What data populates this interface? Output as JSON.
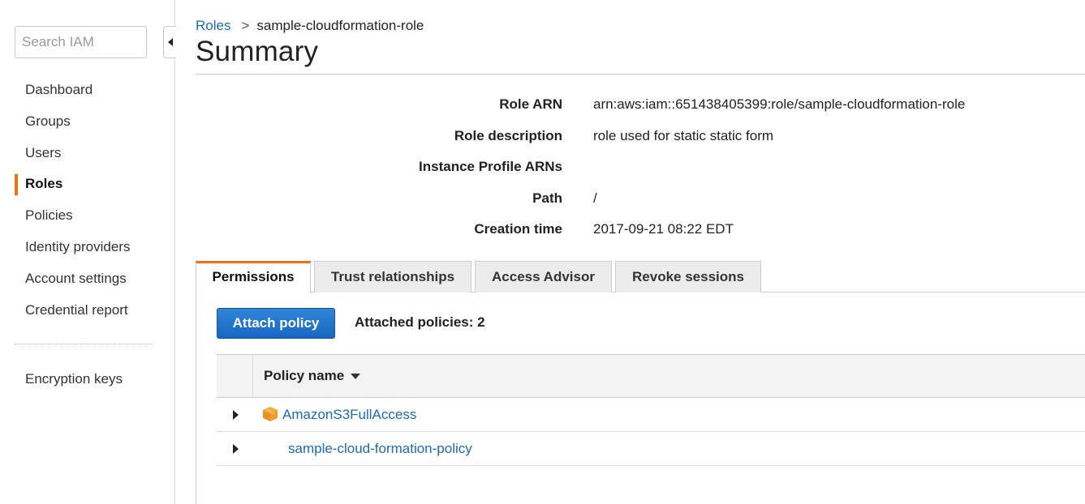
{
  "sidebar": {
    "search_placeholder": "Search IAM",
    "items": [
      {
        "label": "Dashboard"
      },
      {
        "label": "Groups"
      },
      {
        "label": "Users"
      },
      {
        "label": "Roles"
      },
      {
        "label": "Policies"
      },
      {
        "label": "Identity providers"
      },
      {
        "label": "Account settings"
      },
      {
        "label": "Credential report"
      }
    ],
    "extra_items": [
      {
        "label": "Encryption keys"
      }
    ],
    "active_item": "Roles",
    "accent_color": "#ec7211"
  },
  "breadcrumb": {
    "parent": "Roles",
    "separator": ">",
    "current": "sample-cloudformation-role"
  },
  "page_title": "Summary",
  "summary": {
    "rows": [
      {
        "label": "Role ARN",
        "value": "arn:aws:iam::651438405399:role/sample-cloudformation-role"
      },
      {
        "label": "Role description",
        "value": "role used for static static form"
      },
      {
        "label": "Instance Profile ARNs",
        "value": ""
      },
      {
        "label": "Path",
        "value": "/"
      },
      {
        "label": "Creation time",
        "value": "2017-09-21 08:22 EDT"
      }
    ]
  },
  "tabs": [
    {
      "label": "Permissions",
      "active": true
    },
    {
      "label": "Trust relationships",
      "active": false
    },
    {
      "label": "Access Advisor",
      "active": false
    },
    {
      "label": "Revoke sessions",
      "active": false
    }
  ],
  "permissions": {
    "attach_button": "Attach policy",
    "attached_count_text": "Attached policies: 2",
    "button_color": "#1f72cc",
    "table": {
      "column_header": "Policy name",
      "rows": [
        {
          "name": "AmazonS3FullAccess",
          "icon": "aws-managed-cube-icon"
        },
        {
          "name": "sample-cloud-formation-policy",
          "icon": ""
        }
      ]
    }
  }
}
